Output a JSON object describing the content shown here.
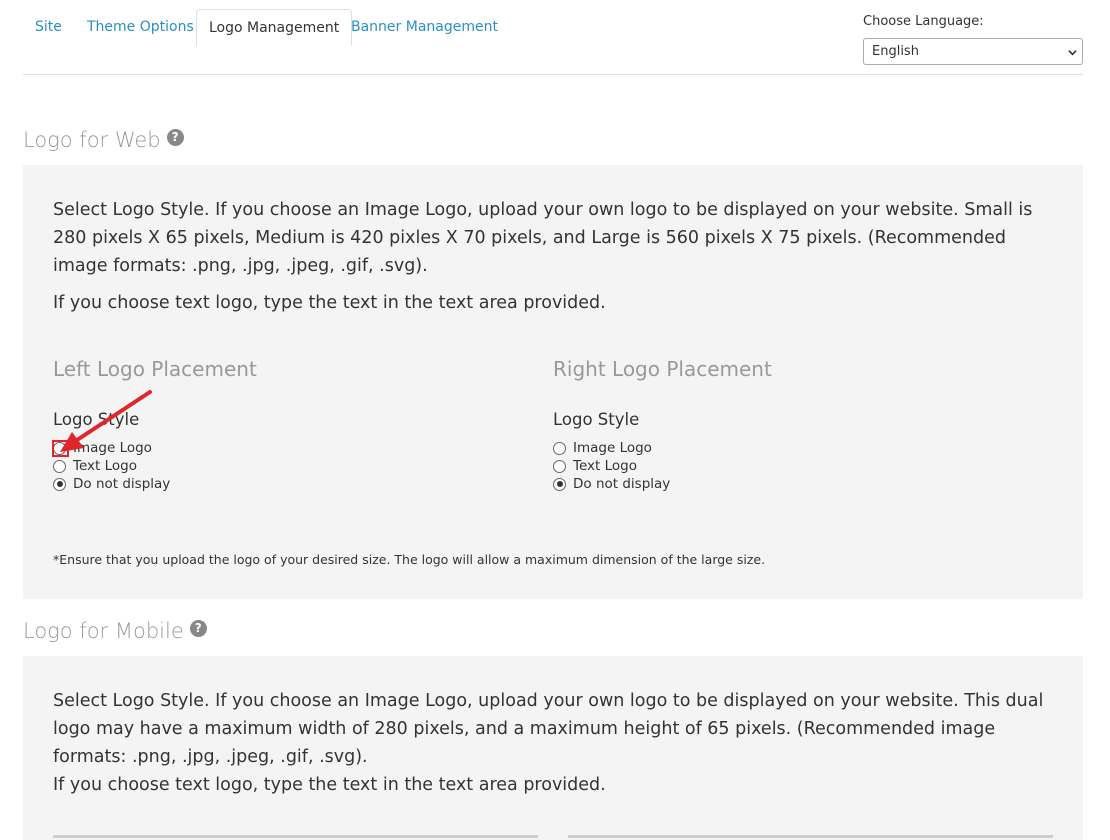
{
  "tabs": [
    {
      "label": "Site"
    },
    {
      "label": "Theme Options"
    },
    {
      "label": "Logo Management"
    },
    {
      "label": "Banner Management"
    }
  ],
  "language": {
    "label": "Choose Language:",
    "selected": "English"
  },
  "web": {
    "title": "Logo for Web",
    "para1": "Select Logo Style. If you choose an Image Logo, upload your own logo to be displayed on your website. Small is 280 pixels X 65 pixels, Medium is 420 pixles X 70 pixels, and Large is 560 pixels X 75 pixels. (Recommended image formats: .png, .jpg, .jpeg, .gif, .svg).",
    "para2": "If you choose text logo, type the text in the text area provided.",
    "left": {
      "title": "Left Logo Placement",
      "style_label": "Logo Style",
      "options": [
        "Image Logo",
        "Text Logo",
        "Do not display"
      ],
      "selected": "Do not display"
    },
    "right": {
      "title": "Right Logo Placement",
      "style_label": "Logo Style",
      "options": [
        "Image Logo",
        "Text Logo",
        "Do not display"
      ],
      "selected": "Do not display"
    },
    "note": "*Ensure that you upload the logo of your desired size. The logo will allow a maximum dimension of the large size."
  },
  "mobile": {
    "title": "Logo for Mobile",
    "para1": "Select Logo Style. If you choose an Image Logo, upload your own logo to be displayed on your website. This dual logo may have a maximum width of 280 pixels, and a maximum height of 65 pixels. (Recommended image formats: .png, .jpg, .jpeg, .gif, .svg).",
    "para2": "If you choose text logo, type the text in the text area provided."
  },
  "colors": {
    "link": "#2a8fc7",
    "panel_bg": "#f4f4f4",
    "annotation": "#e0262b"
  }
}
